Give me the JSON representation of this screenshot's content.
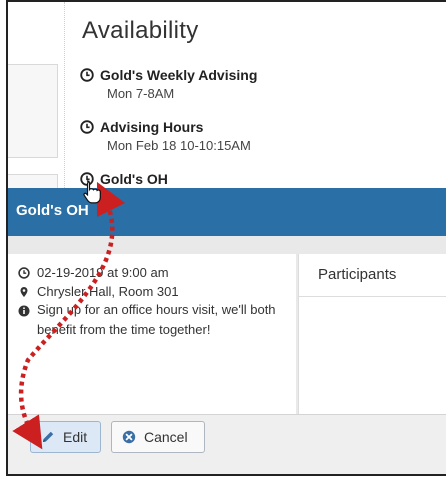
{
  "availability": {
    "title": "Availability",
    "events": [
      {
        "name": "Gold's Weekly Advising",
        "time": "Mon 7-8AM"
      },
      {
        "name": "Advising Hours",
        "time": "Mon Feb 18 10-10:15AM"
      },
      {
        "name": "Gold's OH"
      }
    ]
  },
  "modal": {
    "title": "Gold's OH",
    "datetime": "02-19-2019 at 9:00 am",
    "location": "Chrysler Hall, Room 301",
    "description": "Sign up for an office hours visit, we'll both benefit from the time together!",
    "participants_label": "Participants",
    "edit_label": "Edit",
    "cancel_label": "Cancel"
  },
  "colors": {
    "header": "#2a6fa6",
    "annotation_arrow": "#cc1f1f"
  },
  "icons": {
    "event": "clock-icon",
    "date": "clock-icon",
    "location": "map-pin-icon",
    "info": "info-icon",
    "edit": "pencil-icon",
    "cancel": "cancel-x-icon",
    "cursor": "hand-pointer-icon"
  }
}
